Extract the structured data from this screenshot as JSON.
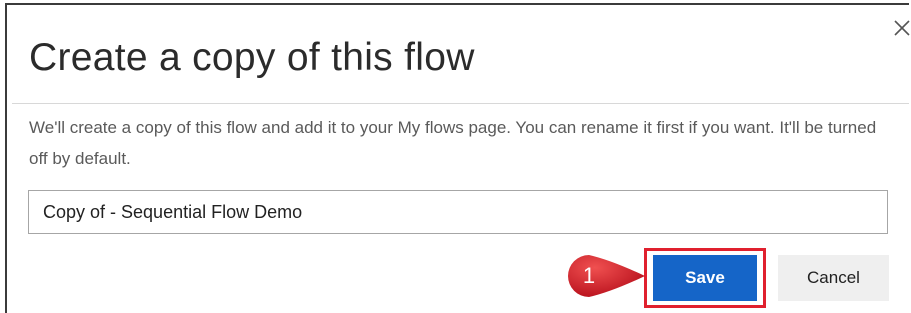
{
  "dialog": {
    "title": "Create a copy of this flow",
    "description": "We'll create a copy of this flow and add it to your My flows page. You can rename it first if you want. It'll be turned off by default.",
    "close_icon": "close-icon",
    "name_input": {
      "value": "Copy of - Sequential Flow Demo"
    },
    "save_label": "Save",
    "cancel_label": "Cancel"
  },
  "annotation": {
    "step_number": "1",
    "color": "#e0202e"
  },
  "colors": {
    "primary_button": "#1565c8",
    "secondary_button": "#efefef",
    "highlight": "#e0202e"
  }
}
